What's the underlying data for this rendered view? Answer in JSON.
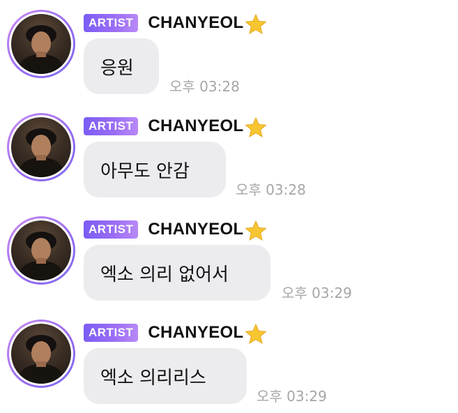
{
  "messages": [
    {
      "badge": "ARTIST",
      "username": "CHANYEOL",
      "name_icon": "star-icon",
      "text": "응원",
      "time": "오후 03:28"
    },
    {
      "badge": "ARTIST",
      "username": "CHANYEOL",
      "name_icon": "star-icon",
      "text": "아무도 안감",
      "time": "오후 03:28"
    },
    {
      "badge": "ARTIST",
      "username": "CHANYEOL",
      "name_icon": "star-icon",
      "text": "엑소 의리 없어서",
      "time": "오후 03:29"
    },
    {
      "badge": "ARTIST",
      "username": "CHANYEOL",
      "name_icon": "star-icon",
      "text": "엑소 의리리스",
      "time": "오후 03:29"
    }
  ],
  "colors": {
    "badge_gradient_start": "#7b5cf5",
    "badge_gradient_end": "#b889f7",
    "avatar_ring": "#9a6cf0",
    "bubble_background": "#ececef",
    "timestamp_text": "#a6a6a8",
    "star": "#f7c531"
  }
}
